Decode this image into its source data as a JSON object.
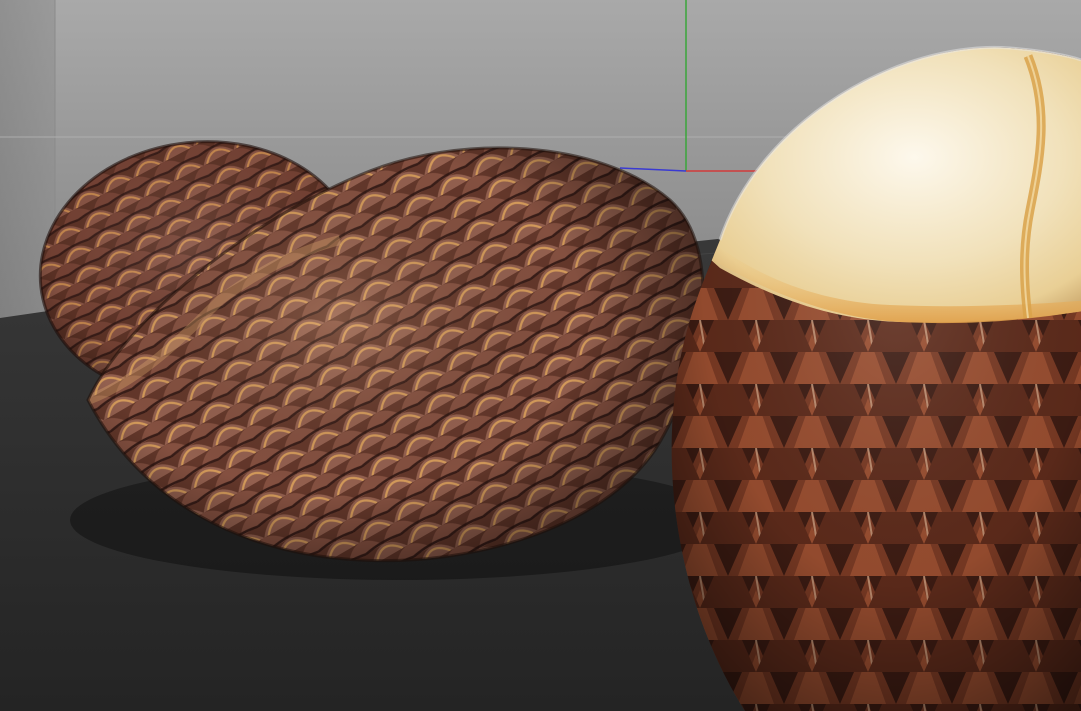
{
  "viewport": {
    "background_top": "#a3a3a3",
    "background_mid": "#7a7a7a",
    "floor_color": "#2b2b2b",
    "horizon_line_color": "#b6b6b6"
  },
  "axes": {
    "x_axis_color": "#d23a3a",
    "y_axis_color": "#3aa63a",
    "z_axis_color": "#3a3ad2"
  },
  "objects": [
    {
      "name": "snake-fruit-whole-back",
      "scale_color": "#6b3a2a",
      "highlight_color": "#c7894d"
    },
    {
      "name": "snake-fruit-whole-front",
      "scale_color": "#7a4534",
      "highlight_color": "#d39a5a"
    },
    {
      "name": "snake-fruit-peeled",
      "flesh_color": "#f2e3bf",
      "flesh_highlight": "#fbf6e8",
      "scale_color": "#5a2a1c",
      "seam_color": "#d9a24a"
    }
  ]
}
